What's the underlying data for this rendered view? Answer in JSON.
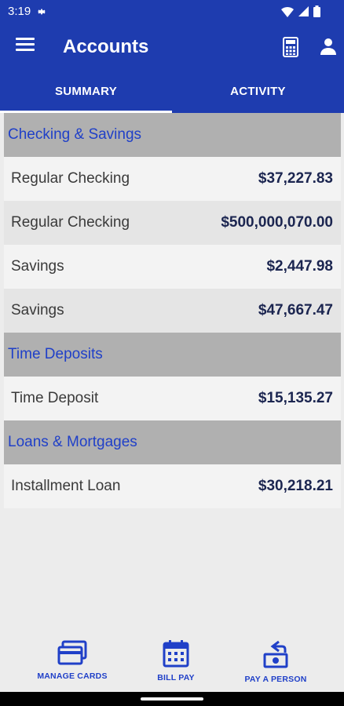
{
  "status": {
    "time": "3:19"
  },
  "app_bar": {
    "title": "Accounts"
  },
  "tabs": [
    {
      "label": "SUMMARY",
      "selected": true
    },
    {
      "label": "ACTIVITY",
      "selected": false
    }
  ],
  "sections": [
    {
      "title": "Checking & Savings",
      "accounts": [
        {
          "name": "Regular Checking",
          "amount": "$37,227.83"
        },
        {
          "name": "Regular Checking",
          "amount": "$500,000,070.00"
        },
        {
          "name": "Savings",
          "amount": "$2,447.98"
        },
        {
          "name": "Savings",
          "amount": "$47,667.47"
        }
      ]
    },
    {
      "title": "Time Deposits",
      "accounts": [
        {
          "name": "Time Deposit",
          "amount": "$15,135.27"
        }
      ]
    },
    {
      "title": "Loans & Mortgages",
      "accounts": [
        {
          "name": "Installment Loan",
          "amount": "$30,218.21"
        }
      ]
    }
  ],
  "bottom_nav": [
    {
      "label": "MANAGE CARDS",
      "icon": "credit-card-icon"
    },
    {
      "label": "BILL PAY",
      "icon": "calendar-icon"
    },
    {
      "label": "PAY A PERSON",
      "icon": "send-money-icon"
    }
  ],
  "colors": {
    "brand_blue": "#1e3caf",
    "section_title": "#2040c8",
    "section_bg": "#b0b0b0",
    "amount_text": "#1b2550"
  }
}
